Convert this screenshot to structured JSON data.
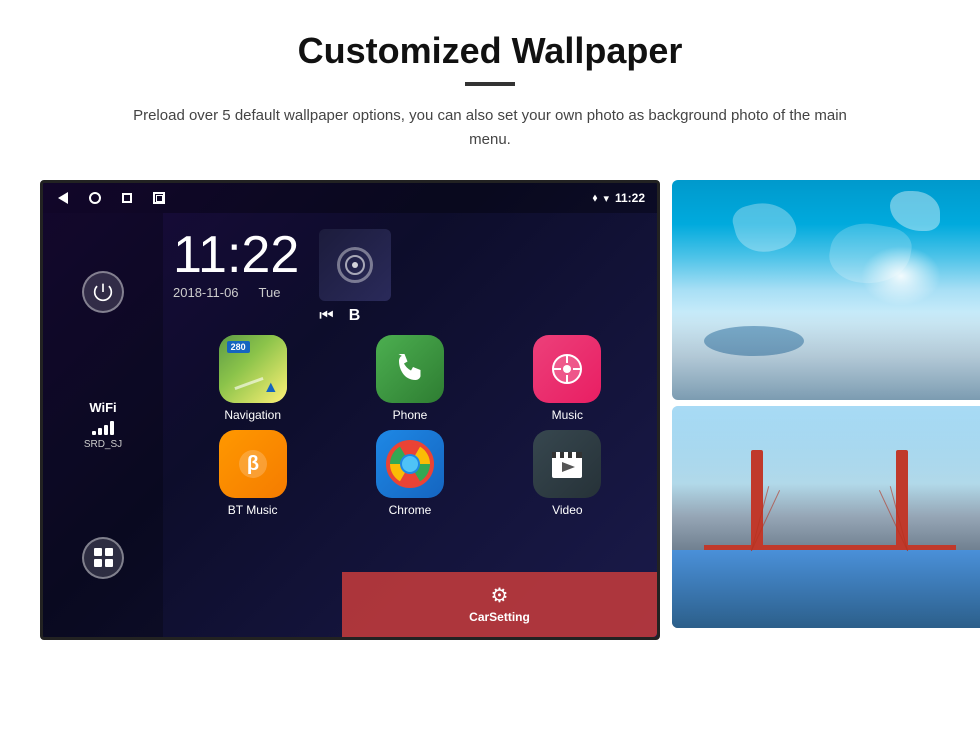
{
  "page": {
    "title": "Customized Wallpaper",
    "divider": true,
    "description": "Preload over 5 default wallpaper options, you can also set your own photo as background photo of the main menu."
  },
  "device": {
    "status_bar": {
      "time": "11:22",
      "wifi": "▾",
      "gps": "⬧",
      "signal": "▲"
    },
    "clock": {
      "time": "11:22",
      "date": "2018-11-06",
      "day": "Tue"
    },
    "sidebar": {
      "wifi_label": "WiFi",
      "wifi_bars": [
        4,
        8,
        12,
        16
      ],
      "network_name": "SRD_SJ"
    },
    "apps": [
      {
        "name": "Navigation",
        "type": "navigation"
      },
      {
        "name": "Phone",
        "type": "phone"
      },
      {
        "name": "Music",
        "type": "music"
      },
      {
        "name": "BT Music",
        "type": "bt-music"
      },
      {
        "name": "Chrome",
        "type": "chrome"
      },
      {
        "name": "Video",
        "type": "video"
      }
    ],
    "carsetting": {
      "label": "CarSetting"
    }
  },
  "wallpapers": [
    {
      "name": "glacier",
      "type": "glacier"
    },
    {
      "name": "bridge",
      "type": "bridge"
    }
  ],
  "icons": {
    "back": "◁",
    "home": "○",
    "recent": "□",
    "screenshot": "⊡",
    "power": "⏻",
    "apps_grid": "⊞",
    "phone": "📞",
    "note": "♪",
    "bluetooth": "⚡",
    "clapper": "🎬",
    "car": "⚙",
    "prev_track": "⏮",
    "next_track": "⏭",
    "map_number": "280"
  }
}
